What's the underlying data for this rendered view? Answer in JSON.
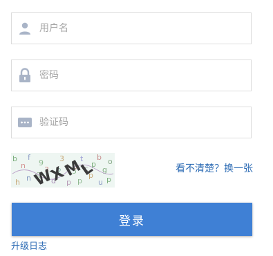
{
  "form": {
    "username": {
      "value": "",
      "placeholder": "用户名",
      "icon": "user-icon"
    },
    "password": {
      "value": "",
      "placeholder": "密码",
      "icon": "lock-icon"
    },
    "captcha": {
      "value": "",
      "placeholder": "验证码",
      "icon": "dots-icon"
    }
  },
  "captcha_image": {
    "text": "WXML"
  },
  "captcha_refresh_label": "看不清楚？换一张",
  "login_button_label": "登录",
  "upgrade_log_label": "升级日志",
  "colors": {
    "accent": "#3f80d5",
    "link": "#2f6db5",
    "icon": "#a9b4c7",
    "border": "#dcdcdc"
  }
}
